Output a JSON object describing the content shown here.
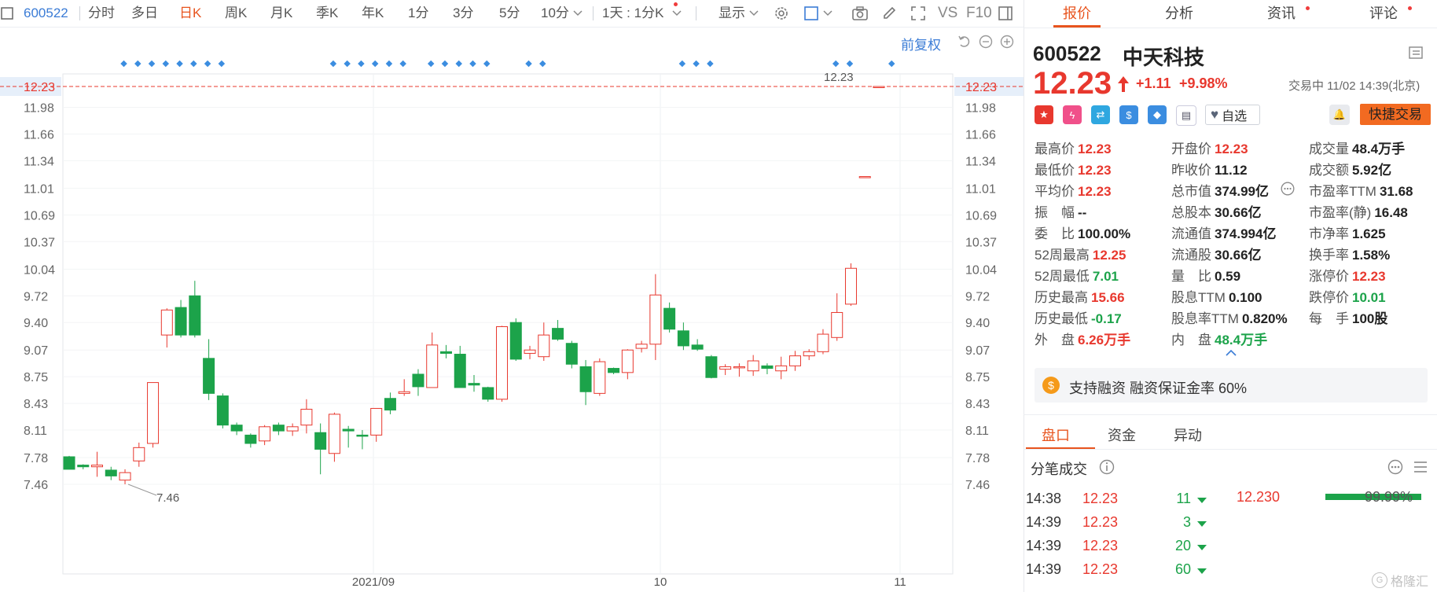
{
  "toolbar": {
    "stock_code": "600522",
    "periods": [
      "分时",
      "多日",
      "日K",
      "周K",
      "月K",
      "季K",
      "年K",
      "1分",
      "3分",
      "5分",
      "10分"
    ],
    "selected_period": "日K",
    "interval_dropdown": "1天 : 1分K",
    "display_label": "显示",
    "tools": [
      "settings-icon",
      "square-icon",
      "camera-icon",
      "pencil-icon",
      "fullscreen-icon"
    ],
    "vs_label": "VS",
    "f10_label": "F10"
  },
  "chart": {
    "adjust_label": "前复权",
    "current_price_label": "12.23",
    "y_ticks": [
      "12.23",
      "11.98",
      "11.66",
      "11.34",
      "11.01",
      "10.69",
      "10.37",
      "10.04",
      "9.72",
      "9.40",
      "9.07",
      "8.75",
      "8.43",
      "8.11",
      "7.78",
      "7.46"
    ],
    "right_y_ticks": [
      "12.23",
      "11.98",
      "11.66",
      "11.34",
      "11.01",
      "10.69",
      "10.37",
      "10.04",
      "9.72",
      "9.40",
      "9.07",
      "8.75",
      "8.43",
      "8.11",
      "7.78",
      "7.46"
    ],
    "x_ticks": [
      "2021/09",
      "10",
      "11"
    ],
    "high_annotation": "12.23",
    "low_annotation": "7.46"
  },
  "chart_data": {
    "type": "candlestick",
    "ylim": [
      7.3,
      12.4
    ],
    "candles": [
      {
        "o": 7.79,
        "h": 7.8,
        "l": 7.64,
        "c": 7.64
      },
      {
        "o": 7.69,
        "h": 7.7,
        "l": 7.64,
        "c": 7.67
      },
      {
        "o": 7.67,
        "h": 7.85,
        "l": 7.55,
        "c": 7.69
      },
      {
        "o": 7.63,
        "h": 7.67,
        "l": 7.51,
        "c": 7.56
      },
      {
        "o": 7.51,
        "h": 7.64,
        "l": 7.46,
        "c": 7.6
      },
      {
        "o": 7.74,
        "h": 7.96,
        "l": 7.67,
        "c": 7.9
      },
      {
        "o": 7.95,
        "h": 8.68,
        "l": 7.9,
        "c": 8.68
      },
      {
        "o": 9.25,
        "h": 9.57,
        "l": 9.1,
        "c": 9.55
      },
      {
        "o": 9.58,
        "h": 9.67,
        "l": 9.22,
        "c": 9.25
      },
      {
        "o": 9.72,
        "h": 9.9,
        "l": 9.22,
        "c": 9.25
      },
      {
        "o": 8.97,
        "h": 9.2,
        "l": 8.47,
        "c": 8.55
      },
      {
        "o": 8.52,
        "h": 8.55,
        "l": 8.13,
        "c": 8.17
      },
      {
        "o": 8.17,
        "h": 8.2,
        "l": 8.05,
        "c": 8.1
      },
      {
        "o": 8.05,
        "h": 8.07,
        "l": 7.9,
        "c": 7.95
      },
      {
        "o": 7.98,
        "h": 8.17,
        "l": 7.93,
        "c": 8.15
      },
      {
        "o": 8.17,
        "h": 8.2,
        "l": 8.05,
        "c": 8.1
      },
      {
        "o": 8.1,
        "h": 8.19,
        "l": 8.04,
        "c": 8.15
      },
      {
        "o": 8.17,
        "h": 8.48,
        "l": 8.07,
        "c": 8.36
      },
      {
        "o": 8.08,
        "h": 8.19,
        "l": 7.58,
        "c": 7.88
      },
      {
        "o": 7.83,
        "h": 8.32,
        "l": 7.73,
        "c": 8.3
      },
      {
        "o": 8.12,
        "h": 8.16,
        "l": 7.9,
        "c": 8.1
      },
      {
        "o": 8.05,
        "h": 8.11,
        "l": 7.88,
        "c": 8.04
      },
      {
        "o": 8.05,
        "h": 8.37,
        "l": 7.97,
        "c": 8.37
      },
      {
        "o": 8.49,
        "h": 8.56,
        "l": 8.3,
        "c": 8.35
      },
      {
        "o": 8.55,
        "h": 8.72,
        "l": 8.52,
        "c": 8.57
      },
      {
        "o": 8.78,
        "h": 8.84,
        "l": 8.52,
        "c": 8.63
      },
      {
        "o": 8.62,
        "h": 9.28,
        "l": 8.62,
        "c": 9.13
      },
      {
        "o": 9.05,
        "h": 9.13,
        "l": 8.97,
        "c": 9.03
      },
      {
        "o": 9.02,
        "h": 9.12,
        "l": 8.62,
        "c": 8.62
      },
      {
        "o": 8.67,
        "h": 8.77,
        "l": 8.57,
        "c": 8.65
      },
      {
        "o": 8.62,
        "h": 8.63,
        "l": 8.45,
        "c": 8.48
      },
      {
        "o": 8.48,
        "h": 9.36,
        "l": 8.45,
        "c": 9.35
      },
      {
        "o": 9.4,
        "h": 9.45,
        "l": 8.94,
        "c": 8.96
      },
      {
        "o": 9.03,
        "h": 9.12,
        "l": 8.96,
        "c": 9.07
      },
      {
        "o": 8.99,
        "h": 9.4,
        "l": 8.94,
        "c": 9.25
      },
      {
        "o": 9.33,
        "h": 9.43,
        "l": 9.18,
        "c": 9.2
      },
      {
        "o": 9.15,
        "h": 9.18,
        "l": 8.85,
        "c": 8.9
      },
      {
        "o": 8.87,
        "h": 8.95,
        "l": 8.41,
        "c": 8.57
      },
      {
        "o": 8.55,
        "h": 8.97,
        "l": 8.52,
        "c": 8.93
      },
      {
        "o": 8.85,
        "h": 8.86,
        "l": 8.78,
        "c": 8.8
      },
      {
        "o": 8.8,
        "h": 9.08,
        "l": 8.72,
        "c": 9.07
      },
      {
        "o": 9.09,
        "h": 9.18,
        "l": 9.04,
        "c": 9.14
      },
      {
        "o": 9.14,
        "h": 9.98,
        "l": 8.95,
        "c": 9.73
      },
      {
        "o": 9.57,
        "h": 9.64,
        "l": 9.28,
        "c": 9.32
      },
      {
        "o": 9.3,
        "h": 9.4,
        "l": 9.07,
        "c": 9.12
      },
      {
        "o": 9.13,
        "h": 9.2,
        "l": 9.06,
        "c": 9.08
      },
      {
        "o": 8.99,
        "h": 9.01,
        "l": 8.73,
        "c": 8.74
      },
      {
        "o": 8.84,
        "h": 8.9,
        "l": 8.77,
        "c": 8.87
      },
      {
        "o": 8.86,
        "h": 8.91,
        "l": 8.75,
        "c": 8.87
      },
      {
        "o": 8.82,
        "h": 9.01,
        "l": 8.76,
        "c": 8.94
      },
      {
        "o": 8.88,
        "h": 8.91,
        "l": 8.78,
        "c": 8.85
      },
      {
        "o": 8.82,
        "h": 8.99,
        "l": 8.72,
        "c": 8.88
      },
      {
        "o": 8.88,
        "h": 9.06,
        "l": 8.82,
        "c": 9.0
      },
      {
        "o": 9.0,
        "h": 9.08,
        "l": 8.95,
        "c": 9.05
      },
      {
        "o": 9.05,
        "h": 9.32,
        "l": 9.02,
        "c": 9.26
      },
      {
        "o": 9.22,
        "h": 9.75,
        "l": 9.18,
        "c": 9.52
      },
      {
        "o": 9.62,
        "h": 10.11,
        "l": 9.6,
        "c": 10.05
      },
      {
        "o": 11.15,
        "h": 11.15,
        "l": 11.15,
        "c": 11.15
      },
      {
        "o": 12.23,
        "h": 12.23,
        "l": 12.23,
        "c": 12.23
      }
    ]
  },
  "quote": {
    "code": "600522",
    "name": "中天科技",
    "price": "12.23",
    "change": "+1.11",
    "change_pct": "+9.98%",
    "status": "交易中 11/02 14:39(北京)",
    "watch_label": "自选",
    "quick_trade_label": "快捷交易"
  },
  "panel_tabs": [
    "报价",
    "分析",
    "资讯",
    "评论"
  ],
  "stats": {
    "col1": [
      {
        "label": "最高价",
        "value": "12.23",
        "color": "red"
      },
      {
        "label": "最低价",
        "value": "12.23",
        "color": "red"
      },
      {
        "label": "平均价",
        "value": "12.23",
        "color": "red"
      },
      {
        "label": "振　幅",
        "value": "--",
        "color": "black"
      },
      {
        "label": "委　比",
        "value": "100.00%",
        "color": "black"
      },
      {
        "label": "52周最高",
        "value": "12.25",
        "color": "red"
      },
      {
        "label": "52周最低",
        "value": "7.01",
        "color": "green"
      },
      {
        "label": "历史最高",
        "value": "15.66",
        "color": "red"
      },
      {
        "label": "历史最低",
        "value": "-0.17",
        "color": "green"
      },
      {
        "label": "外　盘",
        "value": "6.26万手",
        "color": "red"
      }
    ],
    "col2": [
      {
        "label": "开盘价",
        "value": "12.23",
        "color": "red"
      },
      {
        "label": "昨收价",
        "value": "11.12",
        "color": "black"
      },
      {
        "label": "总市值",
        "value": "374.99亿",
        "color": "black"
      },
      {
        "label": "总股本",
        "value": "30.66亿",
        "color": "black"
      },
      {
        "label": "流通值",
        "value": "374.994亿",
        "color": "black"
      },
      {
        "label": "流通股",
        "value": "30.66亿",
        "color": "black"
      },
      {
        "label": "量　比",
        "value": "0.59",
        "color": "black"
      },
      {
        "label": "股息TTM",
        "value": "0.100",
        "color": "black"
      },
      {
        "label": "股息率TTM",
        "value": "0.820%",
        "color": "black"
      },
      {
        "label": "内　盘",
        "value": "48.4万手",
        "color": "green"
      }
    ],
    "col3": [
      {
        "label": "成交量",
        "value": "48.4万手",
        "color": "black"
      },
      {
        "label": "成交额",
        "value": "5.92亿",
        "color": "black"
      },
      {
        "label": "市盈率TTM",
        "value": "31.68",
        "color": "black"
      },
      {
        "label": "市盈率(静)",
        "value": "16.48",
        "color": "black"
      },
      {
        "label": "市净率",
        "value": "1.625",
        "color": "black"
      },
      {
        "label": "换手率",
        "value": "1.58%",
        "color": "black"
      },
      {
        "label": "涨停价",
        "value": "12.23",
        "color": "red"
      },
      {
        "label": "跌停价",
        "value": "10.01",
        "color": "green"
      },
      {
        "label": "每　手",
        "value": "100股",
        "color": "black"
      }
    ]
  },
  "margin_banner": "支持融资 融资保证金率 60%",
  "sub_tabs": [
    "盘口",
    "资金",
    "异动"
  ],
  "ticks_section": {
    "title": "分笔成交",
    "trades": [
      {
        "time": "14:38",
        "price": "12.23",
        "vol": "11"
      },
      {
        "time": "14:39",
        "price": "12.23",
        "vol": "3"
      },
      {
        "time": "14:39",
        "price": "12.23",
        "vol": "20"
      },
      {
        "time": "14:39",
        "price": "12.23",
        "vol": "60"
      }
    ],
    "bid_price": "12.230",
    "bid_pct": "99.99%",
    "bid_fill": 0.9999
  },
  "watermark": "格隆汇"
}
